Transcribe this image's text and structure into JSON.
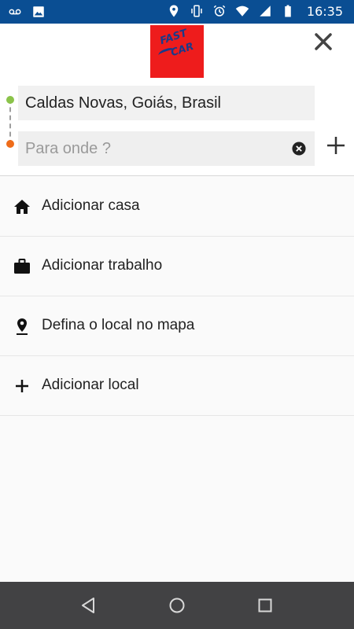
{
  "status_bar": {
    "time": "16:35",
    "left_icons": [
      "voicemail-icon",
      "image-icon"
    ],
    "right_icons": [
      "location-icon",
      "vibrate-icon",
      "alarm-icon",
      "wifi-icon",
      "signal-icon",
      "battery-icon"
    ]
  },
  "logo": {
    "line1": "FAST",
    "line2": "CAR",
    "background": "#ee1c1c"
  },
  "trip": {
    "origin": "Caldas Novas, Goiás, Brasil",
    "destination_value": "",
    "destination_placeholder": "Para onde ?",
    "origin_dot_color": "#8bc34a",
    "destination_dot_color": "#ef6c1a"
  },
  "list": {
    "items": [
      {
        "icon": "home-icon",
        "label": "Adicionar casa"
      },
      {
        "icon": "briefcase-icon",
        "label": "Adicionar trabalho"
      },
      {
        "icon": "map-pin-icon",
        "label": "Defina o local no mapa"
      },
      {
        "icon": "plus-icon",
        "label": "Adicionar local"
      }
    ]
  },
  "nav_bar": {
    "buttons": [
      "back-icon",
      "home-circle-icon",
      "recents-icon"
    ]
  }
}
